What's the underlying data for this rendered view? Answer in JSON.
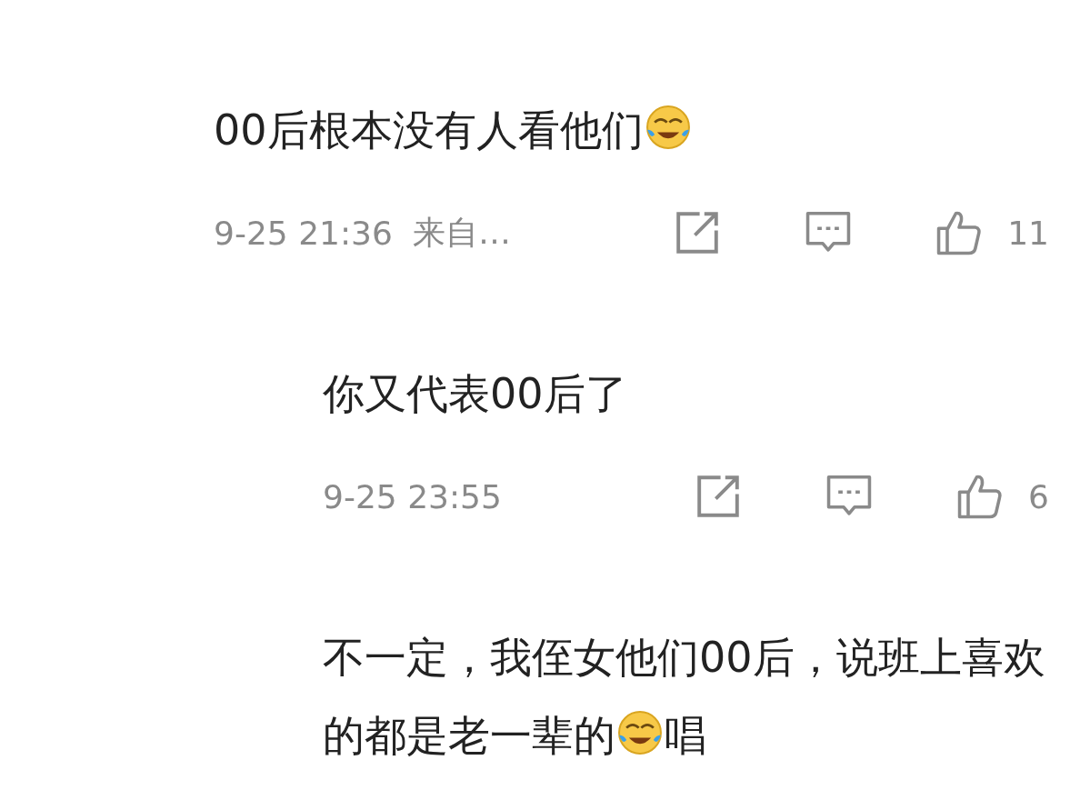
{
  "comments": [
    {
      "parts": [
        {
          "kind": "text",
          "text": "00后根本没有人看他们"
        },
        {
          "kind": "emoji"
        }
      ],
      "time": "9-25 21:36",
      "source": "来自…",
      "likes": "11",
      "replies": [
        {
          "parts": [
            {
              "kind": "text",
              "text": "你又代表00后了"
            }
          ],
          "time": "9-25 23:55",
          "likes": "6"
        },
        {
          "parts": [
            {
              "kind": "text",
              "text": "不一定，我侄女他们00后，说班上喜欢的都是老一辈的"
            },
            {
              "kind": "emoji"
            },
            {
              "kind": "text",
              "text": "唱"
            }
          ]
        }
      ]
    }
  ]
}
